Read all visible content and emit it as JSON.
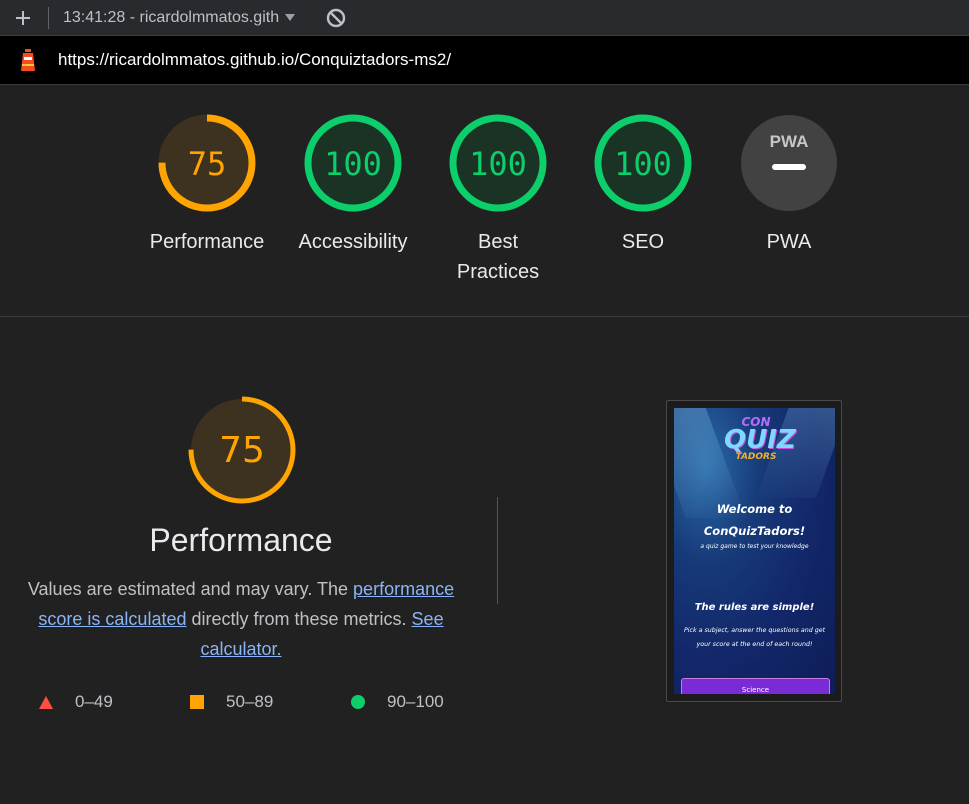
{
  "toolbar": {
    "session_label": "13:41:28 - ricardolmmatos.gith"
  },
  "url": "https://ricardolmmatos.github.io/Conquiztadors-ms2/",
  "colors": {
    "average": "#ffa400",
    "pass": "#0cce6b",
    "fail": "#ff4e42",
    "na": "#9aa0a6"
  },
  "gauges": [
    {
      "label": "Performance",
      "score": "75",
      "value": 75,
      "status": "average"
    },
    {
      "label": "Accessibility",
      "score": "100",
      "value": 100,
      "status": "pass"
    },
    {
      "label": "Best Practices",
      "score": "100",
      "value": 100,
      "status": "pass"
    },
    {
      "label": "SEO",
      "score": "100",
      "value": 100,
      "status": "pass"
    },
    {
      "label": "PWA",
      "score": "PWA",
      "value": null,
      "status": "na"
    }
  ],
  "main": {
    "score": "75",
    "value": 75,
    "title": "Performance",
    "desc_before": "Values are estimated and may vary. The ",
    "desc_link1": "performance score is calculated",
    "desc_middle": " directly from these metrics. ",
    "desc_link2": "See calculator.",
    "legend": [
      {
        "range": "0–49",
        "shape": "triangle-icon",
        "color": "#ff4e42"
      },
      {
        "range": "50–89",
        "shape": "square-icon",
        "color": "#ffa400"
      },
      {
        "range": "90–100",
        "shape": "circle-icon",
        "color": "#0cce6b"
      }
    ]
  },
  "thumbnail": {
    "logo_line1": "CON",
    "logo_line2": "QUIZ",
    "logo_line3": "TADORS",
    "welcome_line1": "Welcome to",
    "welcome_line2": "ConQuizTadors!",
    "subtitle": "a quiz game to test your knowledge",
    "rules_title": "The rules are simple!",
    "rules_line1": "Pick a subject, answer the questions and get",
    "rules_line2": "your score at the end of each round!",
    "button_label": "Science"
  }
}
